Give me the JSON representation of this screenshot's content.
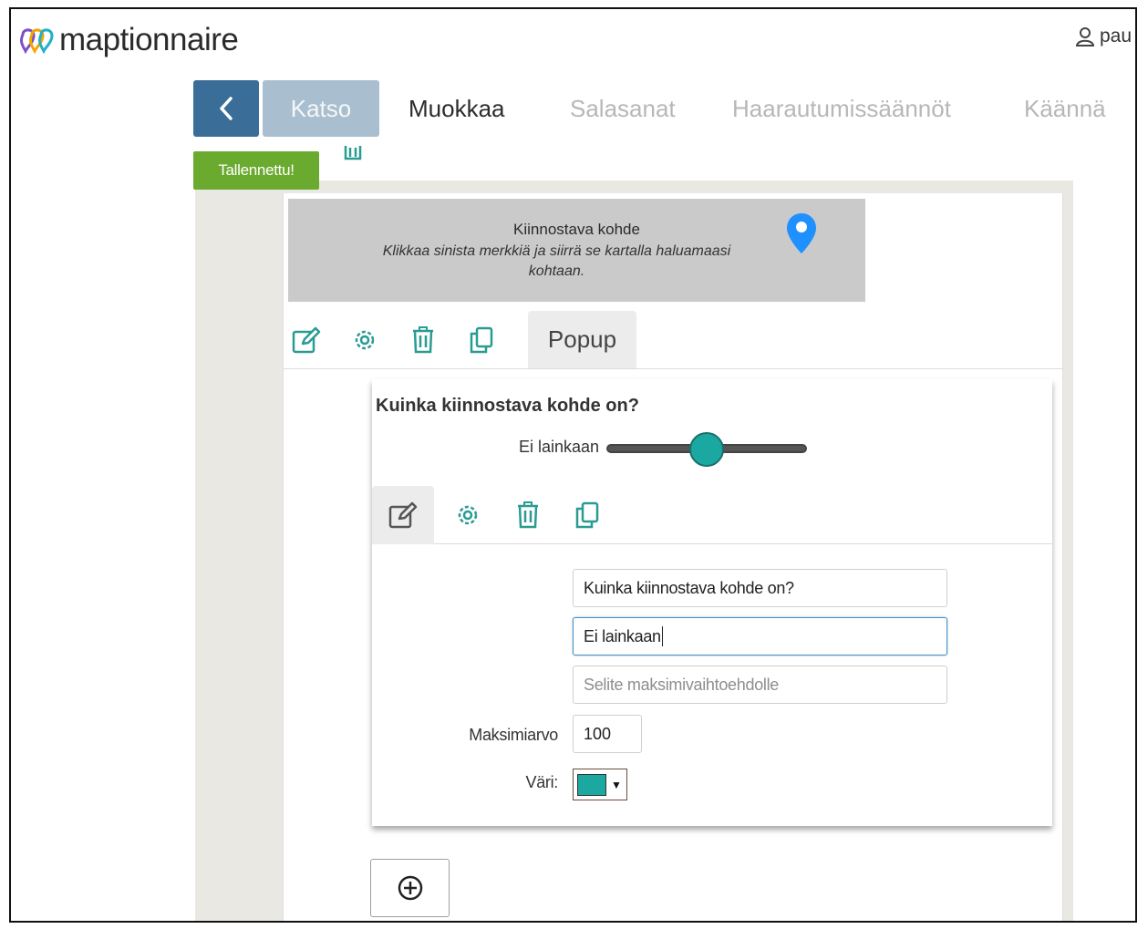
{
  "header": {
    "logo_text": "maptionnaire",
    "user_name": "pau"
  },
  "tabs": {
    "katso": "Katso",
    "muokkaa": "Muokkaa",
    "salasanat": "Salasanat",
    "haarautumissaannot": "Haarautumissäännöt",
    "kaanna": "Käännä"
  },
  "status": {
    "saved_label": "Tallennettu!"
  },
  "map_question": {
    "title": "Kiinnostava kohde",
    "description": "Klikkaa sinista merkkiä ja siirrä se kartalla haluamaasi kohtaan.",
    "popup_tab": "Popup",
    "pin_color": "#1e90ff"
  },
  "slider_question": {
    "title": "Kuinka kiinnostava kohde on?",
    "min_label": "Ei lainkaan",
    "thumb_color": "#1aa8a0",
    "value_fraction": 0.5
  },
  "editor": {
    "title_value": "Kuinka kiinnostava kohde on?",
    "min_label_value": "Ei lainkaan",
    "max_label_placeholder": "Selite maksimivaihtoehdolle",
    "max_value_label": "Maksimiarvo",
    "max_value": "100",
    "color_label": "Väri:",
    "color_value": "#1aa8a0"
  },
  "colors": {
    "back_button": "#3a6e98",
    "active_view_tab": "#a9bfcf",
    "saved_badge": "#6aaa2e"
  }
}
